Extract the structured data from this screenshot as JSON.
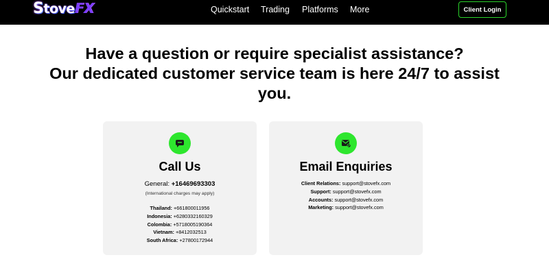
{
  "header": {
    "logo": {
      "first": "S",
      "middle": "tove",
      "accent": "FX"
    },
    "nav": [
      "Quickstart",
      "Trading",
      "Platforms",
      "More"
    ],
    "login_label": "Client Login"
  },
  "headline": {
    "line1": "Have a question or require specialist assistance?",
    "line2": "Our dedicated customer service team is here 24/7 to assist",
    "line3": "you."
  },
  "call": {
    "icon": "phone-chat-icon",
    "title": "Call Us",
    "general_label": "General:",
    "general_number": "+16469693303",
    "note": "(International charges may apply)",
    "rows": [
      {
        "label": "Thailand:",
        "value": "+661800011956"
      },
      {
        "label": "Indonesia:",
        "value": "+6280332160329"
      },
      {
        "label": "Colombia:",
        "value": "+5718005190364"
      },
      {
        "label": "Vietnam:",
        "value": "+8412032513"
      },
      {
        "label": "South Africa:",
        "value": "+27800172944"
      }
    ]
  },
  "email": {
    "icon": "email-icon",
    "title": "Email Enquiries",
    "rows": [
      {
        "label": "Client Relations:",
        "value": "support@stovefx.com"
      },
      {
        "label": "Support:",
        "value": "support@stovefx.com"
      },
      {
        "label": "Accounts:",
        "value": "support@stovefx.com"
      },
      {
        "label": "Marketing:",
        "value": "support@stovefx.com"
      }
    ]
  },
  "colors": {
    "accent": "#2ee62e",
    "header_bg": "#000000",
    "card_bg": "#f2f2f2",
    "logo_accent": "#7b3dff"
  }
}
